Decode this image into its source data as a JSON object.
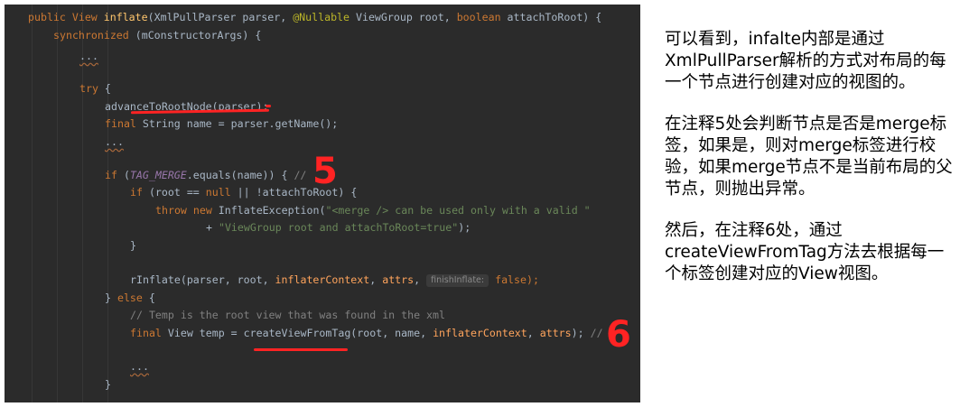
{
  "code": {
    "l01": {
      "a": "public View ",
      "b": "inflate",
      "c": "(XmlPullParser parser, ",
      "d": "@Nullable",
      "e": " ViewGroup root, ",
      "f": "boolean",
      "g": " attachToRoot) {"
    },
    "l02": {
      "a": "synchronized",
      "b": " (mConstructorArgs) {"
    },
    "l03": {
      "a": "..."
    },
    "l05": {
      "a": "try",
      "b": " {"
    },
    "l06": {
      "a": "advanceToRootNode(parser);"
    },
    "l07": {
      "a": "final",
      "b": " String name = parser.getName();"
    },
    "l08": {
      "a": "..."
    },
    "l10": {
      "a": "if",
      "b": " (",
      "c": "TAG_MERGE",
      "d": ".equals(name)) { ",
      "e": "//"
    },
    "l11": {
      "a": "if",
      "b": " (root == ",
      "c": "null",
      "d": " || !attachToRoot) {"
    },
    "l12": {
      "a": "throw new",
      "b": " InflateException(",
      "c": "\"<merge /> can be used only with a valid \""
    },
    "l13": {
      "a": "+ ",
      "b": "\"ViewGroup root and attachToRoot=true\"",
      "c": ");"
    },
    "l14": {
      "a": "}"
    },
    "l16": {
      "a": "rInflate(parser, root, ",
      "b": "inflaterContext",
      "c": ", ",
      "d": "attrs",
      "e": ", ",
      "f": "finishInflate:",
      "g": " false);"
    },
    "l17": {
      "a": "} ",
      "b": "else",
      "c": " {"
    },
    "l18": {
      "a": "// Temp is the root view that was found in the xml"
    },
    "l19": {
      "a": "final",
      "b": " View temp = createViewFromTag(root, name, ",
      "c": "inflaterContext",
      "d": ", ",
      "e": "attrs",
      "f": "); ",
      "g": "//"
    },
    "l21": {
      "a": "..."
    },
    "l22": {
      "a": "}"
    }
  },
  "annotations": {
    "mark_5": "5",
    "mark_6": "6"
  },
  "notes": {
    "p1": "可以看到，infalte内部是通过XmlPullParser解析的方式对布局的每一个节点进行创建对应的视图的。",
    "p2": "在注释5处会判断节点是否是merge标签，如果是，则对merge标签进行校验，如果merge节点不是当前布局的父节点，则抛出异常。",
    "p3": "然后，在注释6处，通过createViewFromTag方法去根据每一个标签创建对应的View视图。"
  },
  "colors": {
    "editor_bg": "#2b2b2b",
    "keyword": "#cc7832",
    "string": "#6a8759",
    "method": "#ffc66d",
    "annotation_red": "#ff2323"
  }
}
